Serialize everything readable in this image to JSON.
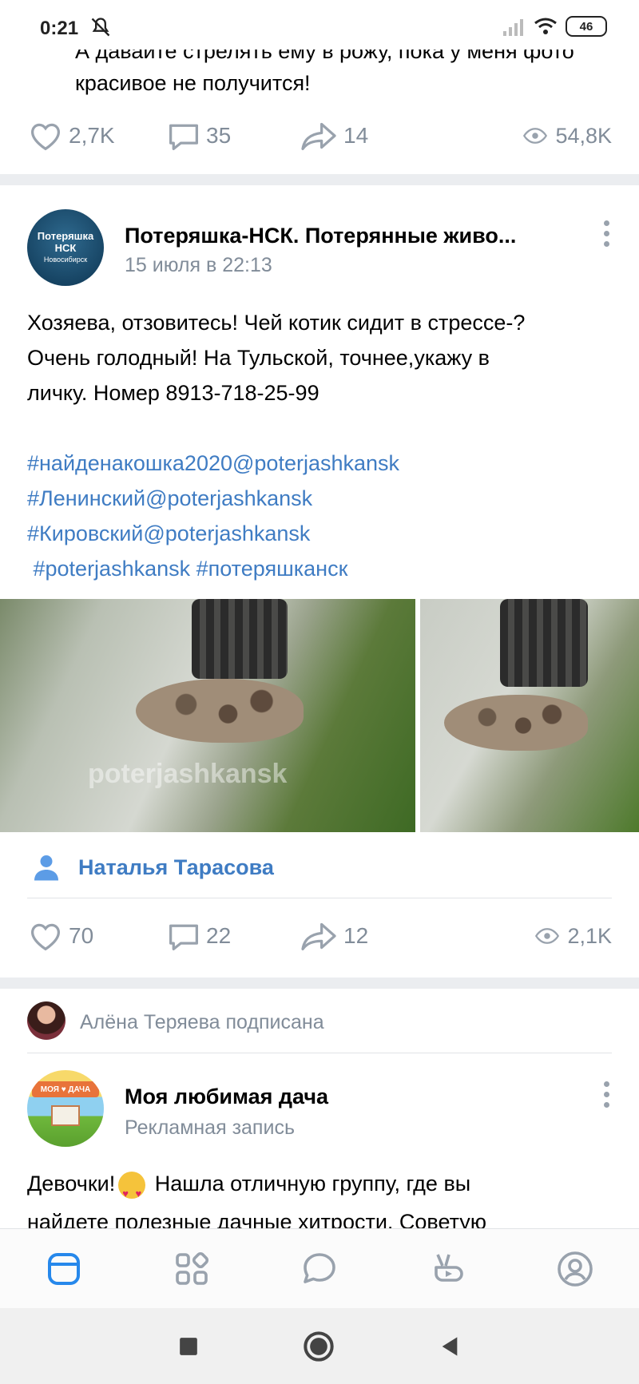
{
  "status_bar": {
    "time": "0:21",
    "battery": "46"
  },
  "prev_post": {
    "text_line1": "А давайте стрелять ему в рожу, пока у меня фото",
    "text_line2": "красивое не получится!",
    "likes": "2,7K",
    "comments": "35",
    "shares": "14",
    "views": "54,8K"
  },
  "post": {
    "avatar_text_1": "Потеряшка",
    "avatar_text_2": "НСК",
    "avatar_text_3": "Новосибирск",
    "author": "Потеряшка-НСК. Потерянные живо...",
    "date": "15 июля в 22:13",
    "text_line1": "Хозяева, отзовитесь! Чей котик сидит в стрессе-?",
    "text_line2": "Очень голодный! На Тульской, точнее,укажу в",
    "text_line3": "личку. Номер 8913-718-25-99",
    "hashtags": [
      "#найденакошка2020@poterjashkansk",
      "#Ленинский@poterjashkansk",
      "#Кировский@poterjashkansk",
      " #poterjashkansk #потеряшканск"
    ],
    "watermark": "poterjashkansk",
    "photo_author": "Наталья Тарасова",
    "likes": "70",
    "comments": "22",
    "shares": "12",
    "views": "2,1K"
  },
  "next_post": {
    "subscribed_text": "Алёна Теряева подписана",
    "avatar_label": "МОЯ ♥ ДАЧА",
    "title": "Моя любимая дача",
    "subtitle": "Рекламная запись",
    "text_part1": "Девочки!",
    "text_part2": " Нашла отличную группу, где вы",
    "text_line2": "найдете полезные дачные хитрости. Советую"
  },
  "colors": {
    "accent": "#3f7cc3",
    "secondary_text": "#818c99",
    "background": "#ebedf0"
  },
  "tabs": [
    "home-icon",
    "services-icon",
    "messages-icon",
    "clips-icon",
    "profile-icon"
  ]
}
